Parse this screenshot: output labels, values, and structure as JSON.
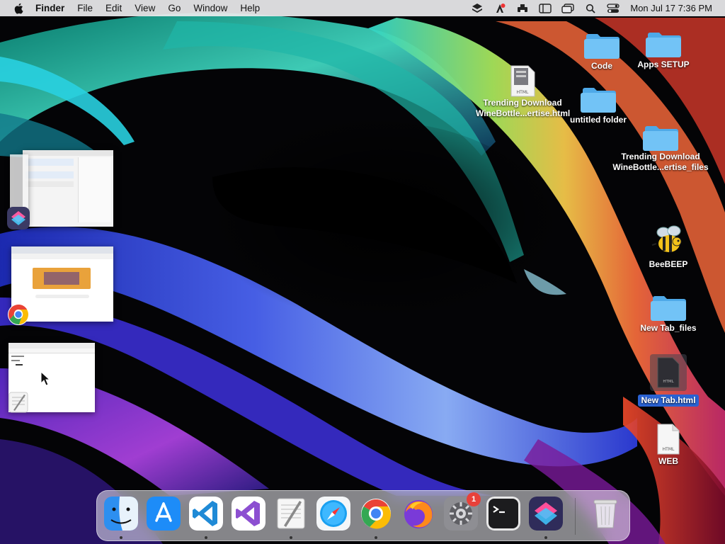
{
  "menubar": {
    "app_name": "Finder",
    "menus": [
      "File",
      "Edit",
      "View",
      "Go",
      "Window",
      "Help"
    ],
    "status_icons": [
      "layers-icon",
      "adobe-icon",
      "printer-icon",
      "sidebar-icon",
      "window-icon",
      "search-icon",
      "control-center-icon"
    ],
    "clock": "Mon Jul 17  7:36 PM"
  },
  "desktop_icons": [
    {
      "name": "Code",
      "kind": "folder"
    },
    {
      "name": "Apps SETUP",
      "kind": "folder"
    },
    {
      "name": "Trending Download WineBottle...ertise.html",
      "line1": "Trending Download",
      "line2": "WineBottle...ertise.html",
      "kind": "html-file"
    },
    {
      "name": "untitled folder",
      "kind": "folder"
    },
    {
      "name": "Trending Download WineBottle...ertise_files",
      "line1": "Trending Download",
      "line2": "WineBottle...ertise_files",
      "kind": "folder"
    },
    {
      "name": "BeeBEEP",
      "kind": "app"
    },
    {
      "name": "New Tab_files",
      "kind": "folder"
    },
    {
      "name": "New Tab.html",
      "kind": "html-file",
      "selected": true
    },
    {
      "name": "WEB",
      "kind": "html-file"
    }
  ],
  "stage_manager": [
    {
      "app": "Shortcuts",
      "icon": "shortcuts-icon"
    },
    {
      "app": "Google Chrome",
      "icon": "chrome-icon"
    },
    {
      "app": "TextEdit",
      "icon": "textedit-icon"
    }
  ],
  "dock": {
    "apps": [
      {
        "name": "Finder",
        "icon": "finder-icon",
        "running": true
      },
      {
        "name": "App Store",
        "icon": "app-store-icon",
        "running": false
      },
      {
        "name": "Visual Studio Code",
        "icon": "vscode-icon",
        "running": true
      },
      {
        "name": "Visual Studio",
        "icon": "visual-studio-icon",
        "running": false
      },
      {
        "name": "TextEdit",
        "icon": "textedit-icon",
        "running": true
      },
      {
        "name": "Safari",
        "icon": "safari-icon",
        "running": false
      },
      {
        "name": "Google Chrome",
        "icon": "chrome-icon",
        "running": true
      },
      {
        "name": "Firefox",
        "icon": "firefox-icon",
        "running": false
      },
      {
        "name": "System Settings",
        "icon": "settings-icon",
        "running": false,
        "badge": "1"
      },
      {
        "name": "Terminal",
        "icon": "terminal-icon",
        "running": false
      },
      {
        "name": "Shortcuts",
        "icon": "shortcuts-icon",
        "running": true
      }
    ],
    "trash": {
      "name": "Trash",
      "icon": "trash-icon"
    }
  },
  "colors": {
    "menubar_bg": "#ebebee",
    "selection": "#2a62d3",
    "folder": "#5cb6f2",
    "badge": "#e8413a"
  }
}
